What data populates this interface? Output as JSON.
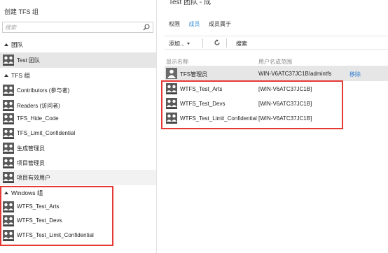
{
  "left_panel": {
    "create_group": "创建 TFS 组",
    "search_placeholder": "搜索",
    "sections": {
      "teams": "团队",
      "tfs_groups": "TFS 组",
      "windows_groups": "Windows 组"
    },
    "team_items": [
      {
        "label": "Test 团队",
        "selected": true
      }
    ],
    "tfs_items": [
      {
        "label": "Contributors (参与者)"
      },
      {
        "label": "Readers (访问者)"
      },
      {
        "label": "TFS_Hide_Code"
      },
      {
        "label": "TFS_Limit_Confidential"
      },
      {
        "label": "生成管理员"
      },
      {
        "label": "项目管理员"
      },
      {
        "label": "项目有效用户"
      }
    ],
    "windows_items": [
      {
        "label": "WTFS_Test_Arts"
      },
      {
        "label": "WTFS_Test_Devs"
      },
      {
        "label": "WTFS_Test_Limit_Confidential"
      }
    ]
  },
  "right_panel": {
    "clipped_title": "Test 团队 - 成",
    "tabs": [
      {
        "label": "权限",
        "active": false
      },
      {
        "label": "成员",
        "active": true
      },
      {
        "label": "成员属于",
        "active": false
      }
    ],
    "toolbar": {
      "add_label": "添加...",
      "search_label": "搜索"
    },
    "columns": {
      "display_name": "显示名称",
      "user_name": "用户名或范围"
    },
    "rows": [
      {
        "display_name": "TFS管理员",
        "user_name": "WIN-V6ATC37JC1B\\admintfs",
        "action": "移除",
        "selected": true,
        "kind": "user"
      },
      {
        "display_name": "WTFS_Test_Arts",
        "user_name": "[WIN-V6ATC37JC1B]",
        "action": "",
        "selected": false,
        "kind": "group"
      },
      {
        "display_name": "WTFS_Test_Devs",
        "user_name": "[WIN-V6ATC37JC1B]",
        "action": "",
        "selected": false,
        "kind": "group"
      },
      {
        "display_name": "WTFS_Test_Limit_Confidential",
        "user_name": "[WIN-V6ATC37JC1B]",
        "action": "",
        "selected": false,
        "kind": "group"
      }
    ]
  },
  "colors": {
    "accent": "#3b8fd9",
    "link": "#2b7cd3",
    "highlight_box": "#e53935",
    "selection": "#e6e6e6"
  }
}
